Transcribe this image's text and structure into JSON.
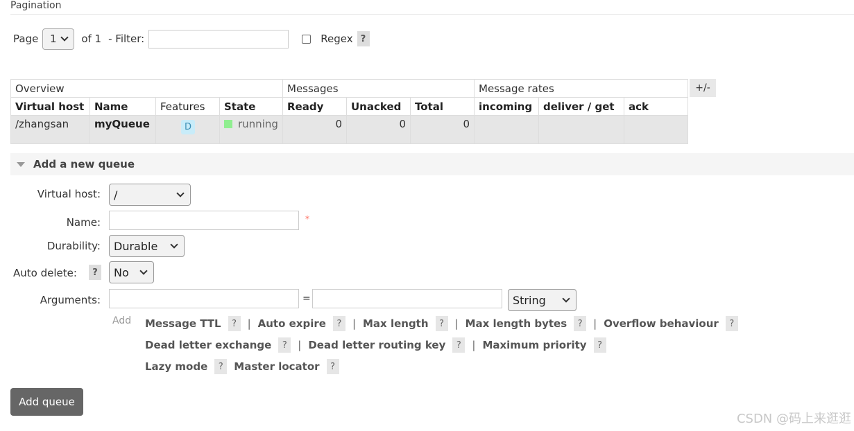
{
  "pagination": {
    "title": "Pagination",
    "page_label": "Page",
    "page_value": "1",
    "of_label": "of 1",
    "filter_label": "- Filter:",
    "filter_value": "",
    "regex_label": "Regex",
    "help": "?"
  },
  "table": {
    "groups": [
      "Overview",
      "Messages",
      "Message rates"
    ],
    "columns": [
      "Virtual host",
      "Name",
      "Features",
      "State",
      "Ready",
      "Unacked",
      "Total",
      "incoming",
      "deliver / get",
      "ack"
    ],
    "rows": [
      {
        "vhost": "/zhangsan",
        "name": "myQueue",
        "feature": "D",
        "state": "running",
        "ready": "0",
        "unacked": "0",
        "total": "0",
        "incoming": "",
        "deliver_get": "",
        "ack": ""
      }
    ],
    "toggle": "+/-",
    "state_color": "#90ee90"
  },
  "add_queue": {
    "title": "Add a new queue",
    "vhost_label": "Virtual host:",
    "vhost_value": "/",
    "name_label": "Name:",
    "name_value": "",
    "required_mark": "*",
    "durability_label": "Durability:",
    "durability_value": "Durable",
    "auto_delete_label": "Auto delete:",
    "auto_delete_value": "No",
    "arguments_label": "Arguments:",
    "arg_key": "",
    "arg_equals": "=",
    "arg_value": "",
    "arg_type": "String",
    "add_label": "Add",
    "help": "?",
    "sep": "|",
    "args_row1": [
      "Message TTL",
      "Auto expire",
      "Max length",
      "Max length bytes",
      "Overflow behaviour"
    ],
    "args_row2": [
      "Dead letter exchange",
      "Dead letter routing key",
      "Maximum priority"
    ],
    "args_row3": [
      "Lazy mode",
      "Master locator"
    ],
    "submit_label": "Add queue"
  },
  "watermark": "CSDN @码上来逛逛"
}
